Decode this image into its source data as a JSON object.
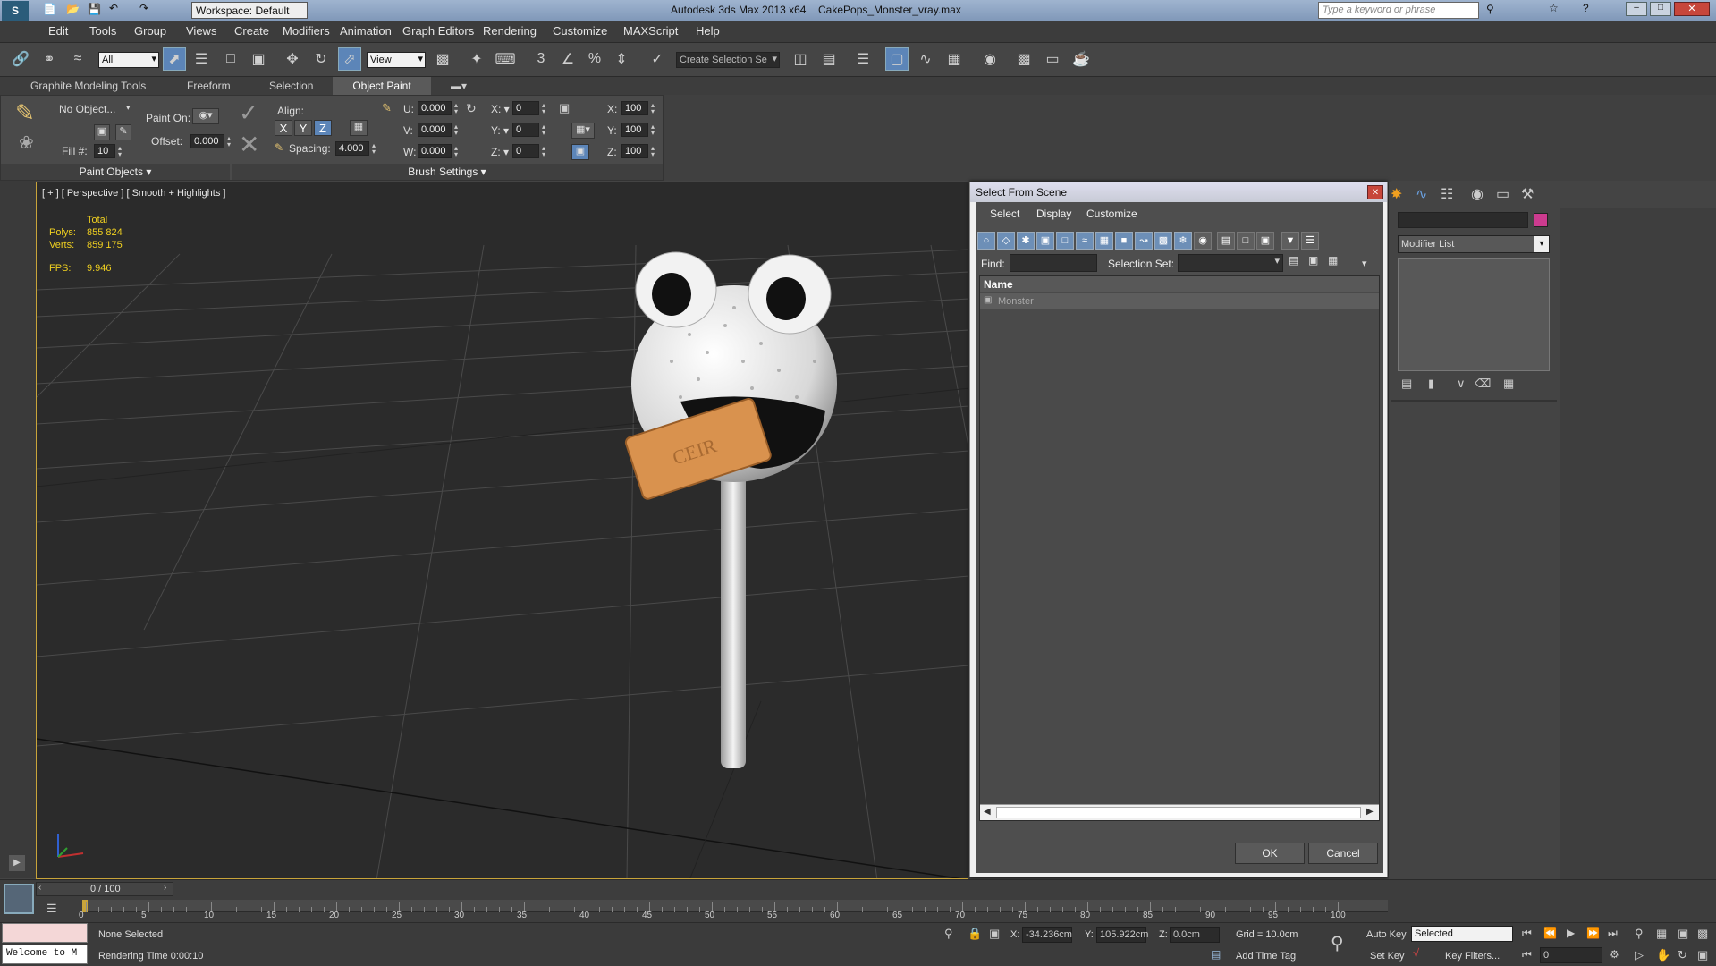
{
  "title": {
    "workspace": "Workspace: Default",
    "app": "Autodesk 3ds Max 2013 x64",
    "file": "CakePops_Monster_vray.max",
    "search_placeholder": "Type a keyword or phrase"
  },
  "menu": [
    "Edit",
    "Tools",
    "Group",
    "Views",
    "Create",
    "Modifiers",
    "Animation",
    "Graph Editors",
    "Rendering",
    "Customize",
    "MAXScript",
    "Help"
  ],
  "toolbar": {
    "filter": "All",
    "refcoord": "View",
    "selset": "Create Selection Se",
    "snaps": [
      "3",
      "2.5",
      "%",
      "n"
    ]
  },
  "ribbon_tabs": [
    "Graphite Modeling Tools",
    "Freeform",
    "Selection",
    "Object Paint"
  ],
  "ribbon": {
    "no_object": "No Object...",
    "paint_on": "Paint On:",
    "offset_label": "Offset:",
    "offset": "0.000",
    "fill_label": "Fill #:",
    "fill": "10",
    "align": "Align:",
    "spacing_label": "Spacing:",
    "spacing": "4.000",
    "u_label": "U:",
    "u": "0.000",
    "v_label": "V:",
    "v": "0.000",
    "w_label": "W:",
    "w": "0.000",
    "x_label": "X:",
    "x": "0",
    "y_label": "Y:",
    "y": "0",
    "z_label": "Z:",
    "z": "0",
    "sx_label": "X:",
    "sx": "100",
    "sy_label": "Y:",
    "sy": "100",
    "sz_label": "Z:",
    "sz": "100",
    "axis": [
      "X",
      "Y",
      "Z"
    ],
    "group1": "Paint Objects",
    "group2": "Brush Settings"
  },
  "viewport": {
    "label": "[ + ] [ Perspective ] [ Smooth + Highlights ]",
    "total": "Total",
    "polys_label": "Polys:",
    "polys": "855 824",
    "verts_label": "Verts:",
    "verts": "859 175",
    "fps_label": "FPS:",
    "fps": "9.946",
    "biscuit_text": "CEIR"
  },
  "dialog": {
    "title": "Select From Scene",
    "menus": [
      "Select",
      "Display",
      "Customize"
    ],
    "find_label": "Find:",
    "selset_label": "Selection Set:",
    "col_name": "Name",
    "items": [
      "Monster"
    ],
    "ok": "OK",
    "cancel": "Cancel"
  },
  "cmdpanel": {
    "modifier_list": "Modifier List",
    "swatch": "#cc3b8f"
  },
  "timeline": {
    "frame": "0 / 100",
    "ticks": [
      "0",
      "5",
      "10",
      "15",
      "20",
      "25",
      "30",
      "35",
      "40",
      "45",
      "50",
      "55",
      "60",
      "65",
      "70",
      "75",
      "80",
      "85",
      "90",
      "95",
      "100"
    ]
  },
  "status": {
    "welcome": "Welcome to M",
    "selected": "None Selected",
    "render_time": "Rendering Time  0:00:10",
    "x_label": "X:",
    "x": "-34.236cm",
    "y_label": "Y:",
    "y": "105.922cm",
    "z_label": "Z:",
    "z": "0.0cm",
    "grid": "Grid = 10.0cm",
    "add_time_tag": "Add Time Tag",
    "auto_key": "Auto Key",
    "set_key": "Set Key",
    "key_mode": "Selected",
    "key_filters": "Key Filters...",
    "frame": "0"
  }
}
